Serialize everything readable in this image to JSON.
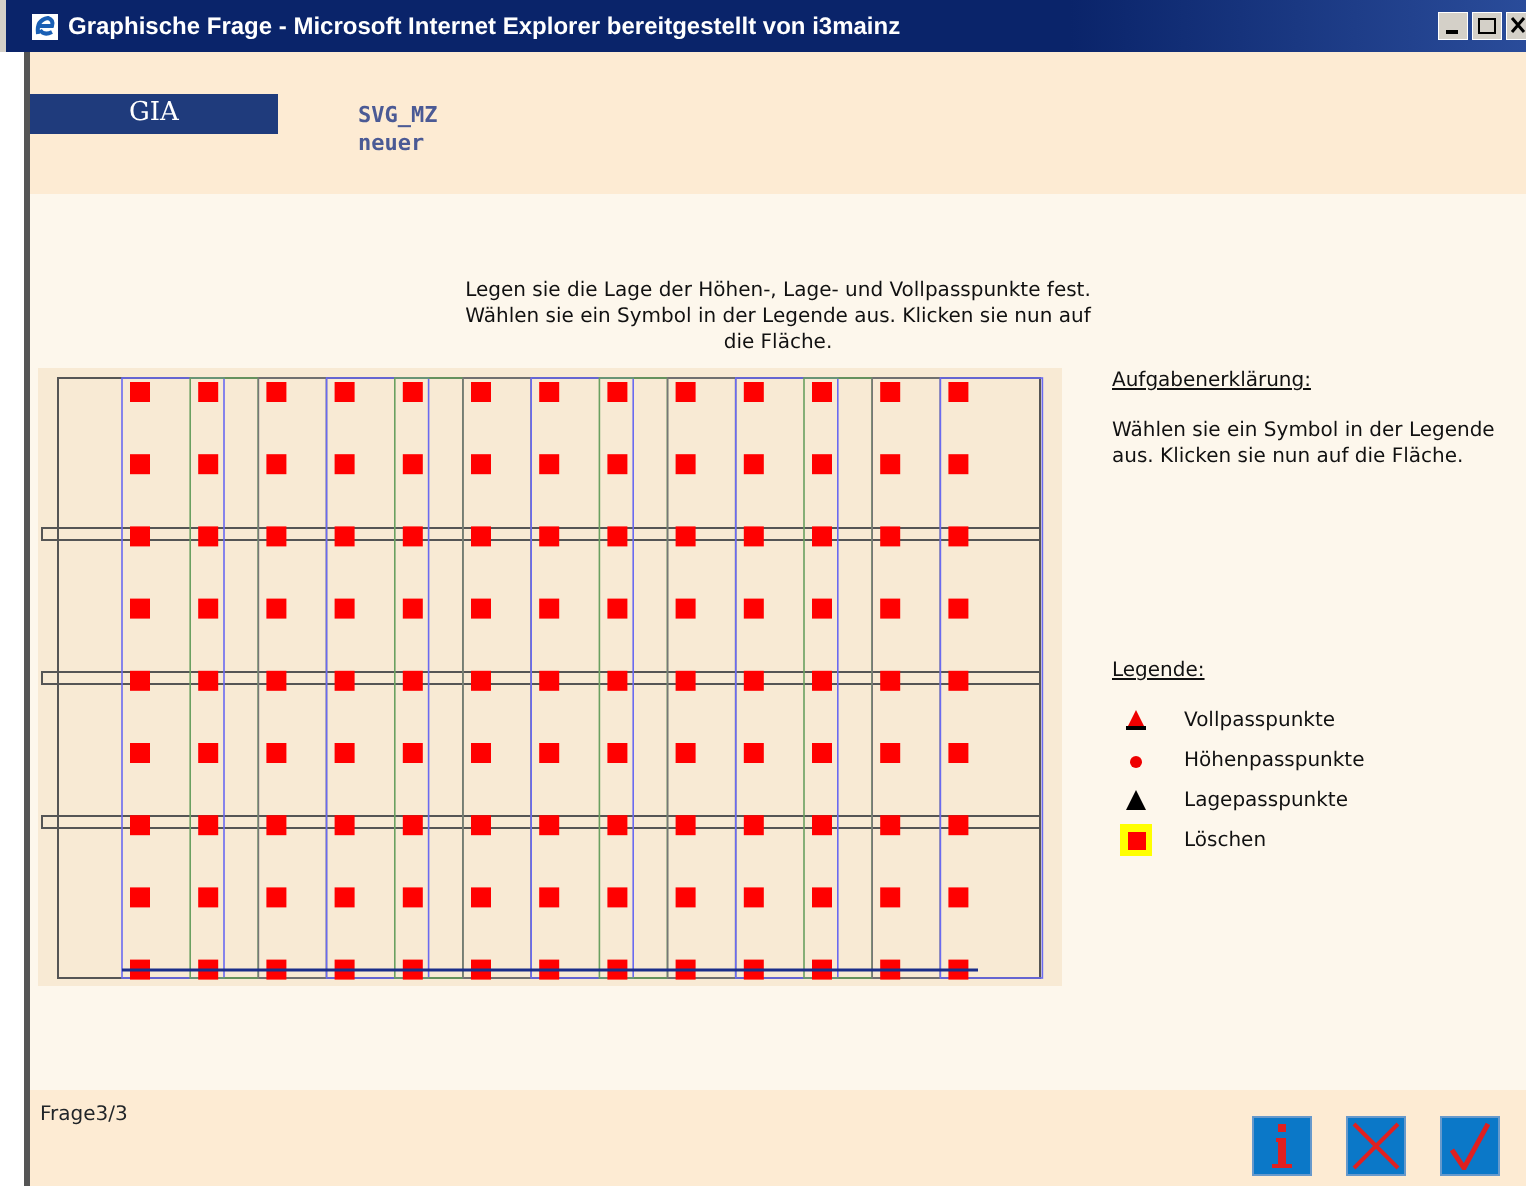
{
  "window": {
    "title": "Graphische Frage - Microsoft Internet Explorer bereitgestellt von i3mainz"
  },
  "header": {
    "logo": "GIA",
    "project": [
      "SVG_MZ",
      "neuer"
    ]
  },
  "instruction": "Legen sie die Lage der Höhen-, Lage- und Vollpasspunkte fest. Wählen sie ein Symbol in der Legende aus. Klicken sie nun auf die Fläche.",
  "explanation": {
    "heading": "Aufgabenerklärung:",
    "text": "Wählen sie ein Symbol in der Legende aus. Klicken sie nun auf die Fläche."
  },
  "legend": {
    "heading": "Legende:",
    "items": [
      {
        "kind": "full",
        "label": "Vollpasspunkte",
        "selected": false
      },
      {
        "kind": "height",
        "label": "Höhenpasspunkte",
        "selected": false
      },
      {
        "kind": "position",
        "label": "Lagepasspunkte",
        "selected": false
      },
      {
        "kind": "delete",
        "label": "Löschen",
        "selected": true
      }
    ]
  },
  "footer": {
    "counter": "Frage3/3",
    "buttons": [
      {
        "kind": "info"
      },
      {
        "kind": "cancel"
      },
      {
        "kind": "ok"
      }
    ]
  }
}
